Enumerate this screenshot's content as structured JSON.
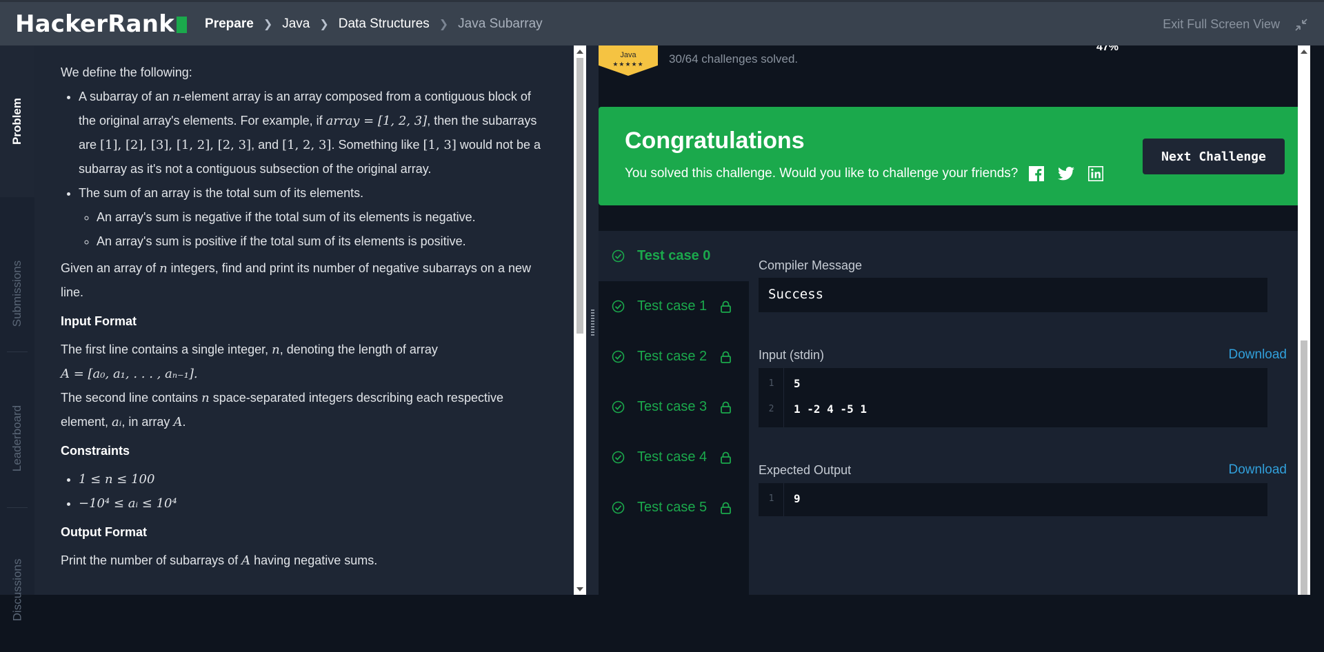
{
  "topbar": {
    "logo": "HackerRank",
    "breadcrumb": [
      "Prepare",
      "Java",
      "Data Structures",
      "Java Subarray"
    ],
    "exit_label": "Exit Full Screen View"
  },
  "sidetabs": [
    "Problem",
    "Submissions",
    "Leaderboard",
    "Discussions"
  ],
  "problem": {
    "intro": "We define the following:",
    "bullet1_a": "A subarray of an ",
    "bullet1_n": "n",
    "bullet1_b": "-element array is an array composed from a contiguous block of the original array's elements. For example, if ",
    "bullet1_arr": "array = [1, 2, 3]",
    "bullet1_c": ", then the subarrays are ",
    "bullet1_subs": "[1], [2], [3], [1, 2], [2, 3]",
    "bullet1_d": ", and ",
    "bullet1_full": "[1, 2, 3]",
    "bullet1_e": ". Something like ",
    "bullet1_ex": "[1, 3]",
    "bullet1_f": " would not be a subarray as it's not a contiguous subsection of the original array.",
    "bullet2": "The sum of an array is the total sum of its elements.",
    "sub1": "An array's sum is negative if the total sum of its elements is negative.",
    "sub2": "An array's sum is positive if the total sum of its elements is positive.",
    "given_a": "Given an array of ",
    "given_n": "n",
    "given_b": " integers, find and print its number of negative subarrays on a new line.",
    "input_heading": "Input Format",
    "input1_a": "The first line contains a single integer, ",
    "input1_n": "n",
    "input1_b": ", denoting the length of array",
    "input1_math": "A = [a₀, a₁, . . . , aₙ₋₁].",
    "input2_a": "The second line contains ",
    "input2_n": "n",
    "input2_b": " space-separated integers describing each respective element, ",
    "input2_ai": "aᵢ",
    "input2_c": ", in array ",
    "input2_A": "A",
    "input2_d": ".",
    "constraints_heading": "Constraints",
    "c1": "1 ≤ n ≤ 100",
    "c2": "−10⁴ ≤ aᵢ ≤ 10⁴",
    "output_heading": "Output Format",
    "output_a": "Print the number of subarrays of ",
    "output_A": "A",
    "output_b": " having negative sums."
  },
  "progress": {
    "badge_label": "Java",
    "badge_stars": "★★★★★",
    "solved": "30/64 challenges solved.",
    "percent": "47%"
  },
  "congrats": {
    "title": "Congratulations",
    "message": "You solved this challenge. Would you like to challenge your friends?",
    "next_label": "Next Challenge"
  },
  "testcases": [
    "Test case 0",
    "Test case 1",
    "Test case 2",
    "Test case 3",
    "Test case 4",
    "Test case 5"
  ],
  "result": {
    "compiler_label": "Compiler Message",
    "compiler_value": "Success",
    "input_label": "Input (stdin)",
    "download_label": "Download",
    "input_lines": [
      "5",
      "1 -2 4 -5 1"
    ],
    "line_numbers": [
      "1",
      "2"
    ],
    "expected_label": "Expected Output",
    "expected_lines": [
      "9"
    ]
  },
  "colors": {
    "accent_green": "#1ba94c",
    "link_blue": "#31a0db",
    "badge_gold": "#f5c342"
  }
}
